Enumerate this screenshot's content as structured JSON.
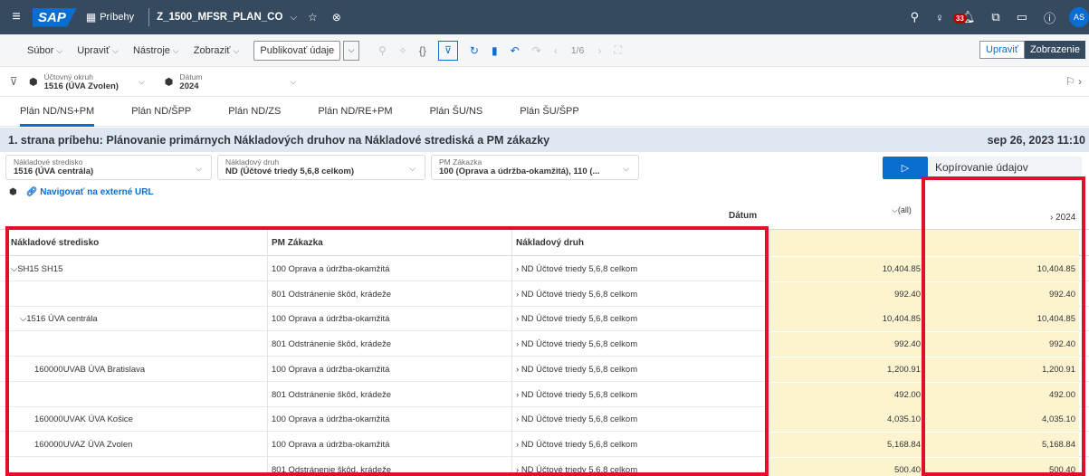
{
  "shell": {
    "app_name": "Príbehy",
    "story_name": "Z_1500_MFSR_PLAN_CO",
    "notification_count": "33",
    "avatar_initials": "AS",
    "brand_color": "#354a5f"
  },
  "toolbar": {
    "menus": [
      "Súbor",
      "Upraviť",
      "Nástroje",
      "Zobraziť"
    ],
    "publish_label": "Publikovať údaje",
    "pages": "1/6",
    "edit_label": "Upraviť",
    "view_label": "Zobrazenie"
  },
  "filters": [
    {
      "label": "Účtovný okruh",
      "value": "1516 (ÚVA Zvolen)"
    },
    {
      "label": "Dátum",
      "value": "2024"
    }
  ],
  "tabs": [
    "Plán ND/NS+PM",
    "Plán ND/ŠPP",
    "Plán ND/ZS",
    "Plán ND/RE+PM",
    "Plán ŠU/NS",
    "Plán ŠU/ŠPP"
  ],
  "page": {
    "title": "1. strana príbehu: Plánovanie primárnych Nákladových druhov na Nákladové strediská a PM zákazky",
    "date": "sep 26, 2023 11:10"
  },
  "inputs": [
    {
      "label": "Nákladové stredisko",
      "value": "1516 (ÚVA centrála)"
    },
    {
      "label": "Nákladový druh",
      "value": "ND (Účtové triedy 5,6,8 celkom)"
    },
    {
      "label": "PM Zákazka",
      "value": "100 (Oprava a údržba-okamžitá), 110 (..."
    }
  ],
  "copy_label": "Kopírovanie údajov",
  "link_label": "Navigovať na externé URL",
  "table": {
    "datum_label": "Dátum",
    "all_label": "(all)",
    "year_label": "2024",
    "headers": [
      "Nákladové stredisko",
      "PM Zákazka",
      "Nákladový druh"
    ],
    "rows": [
      {
        "cc": "SH15 SH15",
        "cc_expand": "v",
        "order": "100 Oprava a údržba-okamžitá",
        "type": "ND Účtové triedy 5,6,8 celkom",
        "all": "10,404.85",
        "y2024": "10,404.85"
      },
      {
        "cc": "",
        "cc_expand": "",
        "order": "801 Odstránenie škôd, krádeže",
        "type": "ND Účtové triedy 5,6,8 celkom",
        "all": "992.40",
        "y2024": "992.40"
      },
      {
        "cc": "1516 ÚVA centrála",
        "cc_expand": "v",
        "order": "100 Oprava a údržba-okamžitá",
        "type": "ND Účtové triedy 5,6,8 celkom",
        "all": "10,404.85",
        "y2024": "10,404.85"
      },
      {
        "cc": "",
        "cc_expand": "",
        "order": "801 Odstránenie škôd, krádeže",
        "type": "ND Účtové triedy 5,6,8 celkom",
        "all": "992.40",
        "y2024": "992.40"
      },
      {
        "cc": "160000UVAB ÚVA Bratislava",
        "cc_expand": "",
        "order": "100 Oprava a údržba-okamžitá",
        "type": "ND Účtové triedy 5,6,8 celkom",
        "all": "1,200.91",
        "y2024": "1,200.91"
      },
      {
        "cc": "",
        "cc_expand": "",
        "order": "801 Odstránenie škôd, krádeže",
        "type": "ND Účtové triedy 5,6,8 celkom",
        "all": "492.00",
        "y2024": "492.00"
      },
      {
        "cc": "160000UVAK ÚVA Košice",
        "cc_expand": "",
        "order": "100 Oprava a údržba-okamžitá",
        "type": "ND Účtové triedy 5,6,8 celkom",
        "all": "4,035.10",
        "y2024": "4,035.10"
      },
      {
        "cc": "160000UVAZ ÚVA Zvolen",
        "cc_expand": "",
        "order": "100 Oprava a údržba-okamžitá",
        "type": "ND Účtové triedy 5,6,8 celkom",
        "all": "5,168.84",
        "y2024": "5,168.84"
      },
      {
        "cc": "",
        "cc_expand": "",
        "order": "801 Odstránenie škôd, krádeže",
        "type": "ND Účtové triedy 5,6,8 celkom",
        "all": "500.40",
        "y2024": "500.40"
      }
    ]
  },
  "highlight_color": "#e0102a"
}
